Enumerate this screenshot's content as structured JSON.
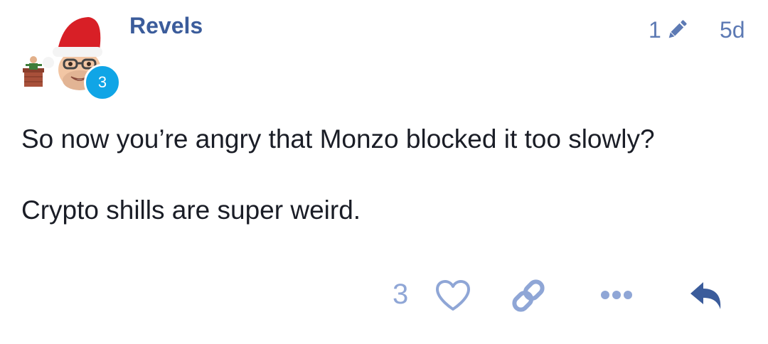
{
  "post": {
    "username": "Revels",
    "trust_level": "3",
    "edit_count": "1",
    "age": "5d",
    "paragraphs": [
      "So now you’re angry that Monzo blocked it too slowly?",
      "Crypto shills are super weird."
    ],
    "like_count": "3"
  },
  "icons": {
    "edit": "pencil-icon",
    "like": "heart-icon",
    "share": "link-icon",
    "more": "ellipsis-icon",
    "reply": "reply-icon"
  },
  "colors": {
    "username": "#3b5c9b",
    "meta": "#5d7ab4",
    "body_text": "#1a1d26",
    "actions": "#8fa6d6",
    "reply": "#3b5c9b",
    "badge": "#10a5e6"
  }
}
